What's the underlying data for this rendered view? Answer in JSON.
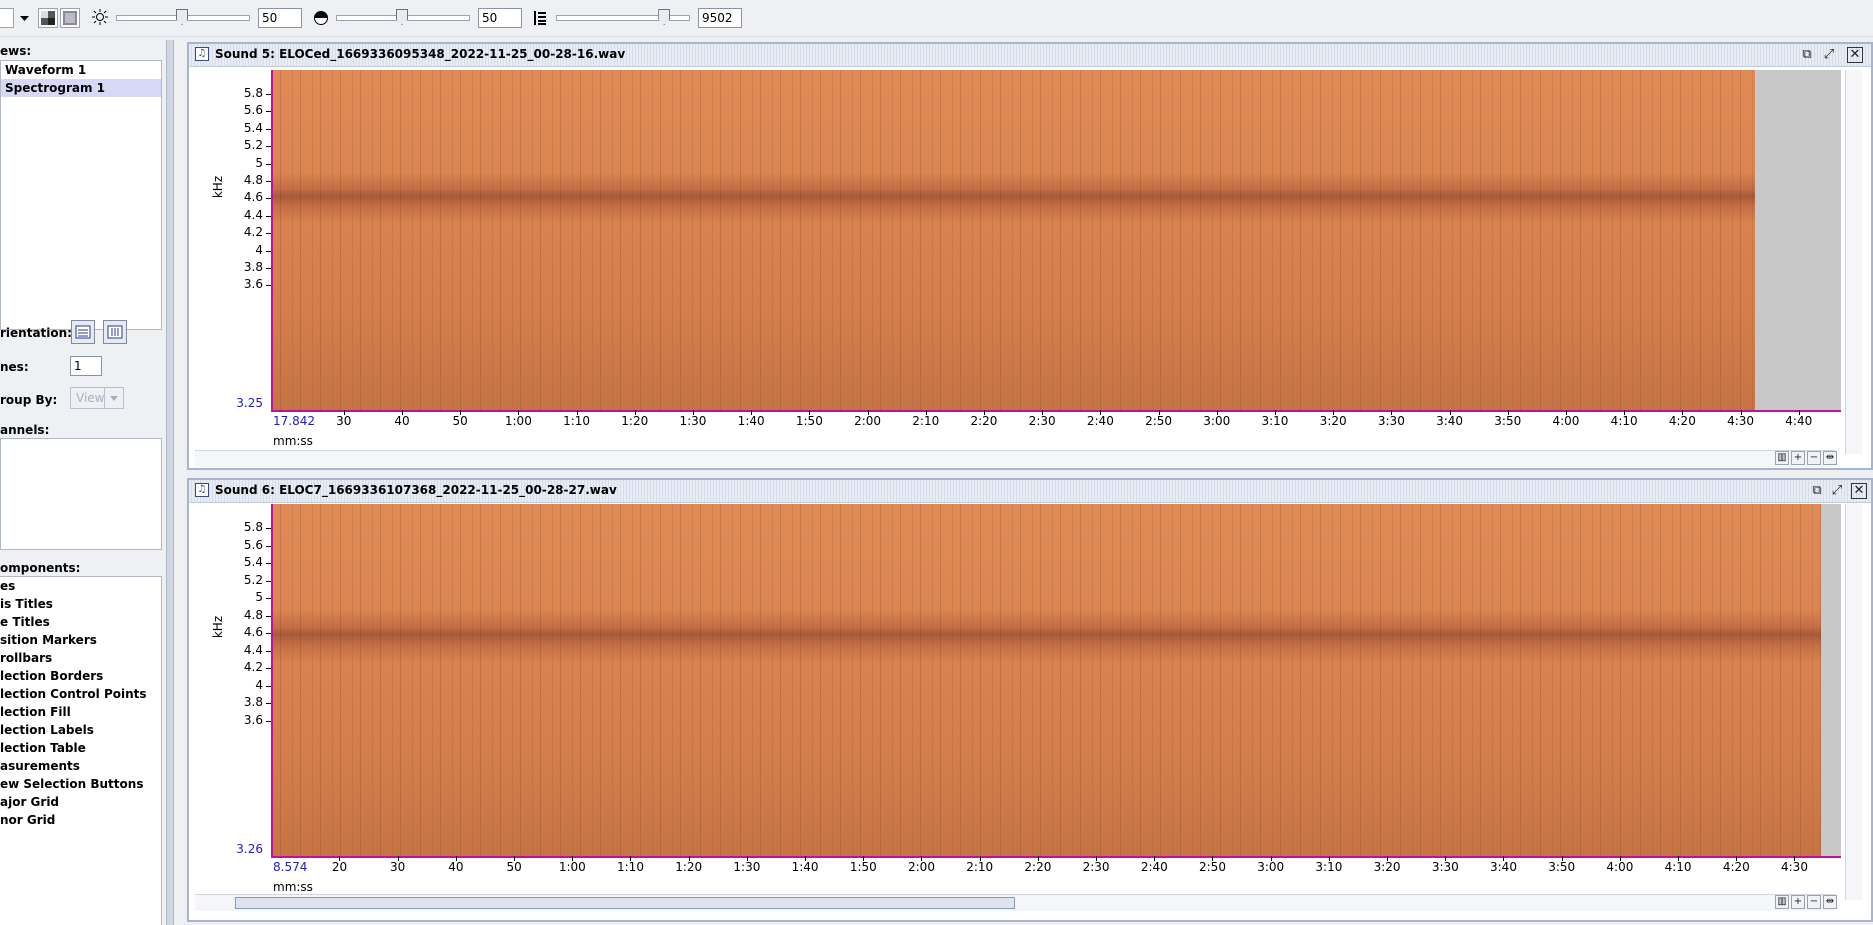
{
  "toolbar": {
    "brightness_value": "50",
    "brightness_level": 0.5,
    "contrast_value": "50",
    "contrast_level": 0.5,
    "resolution_value": "9502",
    "resolution_level": 0.82,
    "icons": [
      "dropdown-arrow-icon",
      "grayscale-icon",
      "colormap-icon",
      "brightness-icon",
      "contrast-icon",
      "resolution-icon"
    ]
  },
  "left_panel": {
    "views_label": "ews:",
    "views": [
      {
        "label": "Waveform 1",
        "selected": false
      },
      {
        "label": "Spectrogram 1",
        "selected": true
      }
    ],
    "orientation_label": "rientation:",
    "lines_label": "nes:",
    "lines_value": "1",
    "group_by_label": "roup By:",
    "group_by_value": "View",
    "channels_label": "annels:",
    "components_label": "omponents:",
    "components": [
      "es",
      "is Titles",
      "e Titles",
      "sition Markers",
      "rollbars",
      "lection Borders",
      "lection Control Points",
      "lection Fill",
      "lection Labels",
      "lection Table",
      "asurements",
      "ew Selection Buttons",
      "ajor Grid",
      "nor Grid"
    ]
  },
  "sounds": [
    {
      "title": "Sound 5: ELOCed_1669336095348_2022-11-25_00-28-16.wav",
      "y_label": "kHz",
      "y_min_label": "3.25",
      "y_ticks": [
        "5.8",
        "5.6",
        "5.4",
        "5.2",
        "5",
        "4.8",
        "4.6",
        "4.4",
        "4.2",
        "4",
        "3.8",
        "3.6"
      ],
      "x_start_label": "17.842",
      "x_ticks": [
        "30",
        "40",
        "50",
        "1:00",
        "1:10",
        "1:20",
        "1:30",
        "1:40",
        "1:50",
        "2:00",
        "2:10",
        "2:20",
        "2:30",
        "2:40",
        "2:50",
        "3:00",
        "3:10",
        "3:20",
        "3:30",
        "3:40",
        "3:50",
        "4:00",
        "4:10",
        "4:20",
        "4:30",
        "4:40"
      ],
      "x_label": "mm:ss",
      "x_start_seconds": 17.842,
      "x_tick_seconds": [
        30,
        40,
        50,
        60,
        70,
        80,
        90,
        100,
        110,
        120,
        130,
        140,
        150,
        160,
        170,
        180,
        190,
        200,
        210,
        220,
        230,
        240,
        250,
        260,
        270,
        280
      ],
      "data_end_seconds": 272.5
    },
    {
      "title": "Sound 6: ELOC7_1669336107368_2022-11-25_00-28-27.wav",
      "y_label": "kHz",
      "y_min_label": "3.26",
      "y_ticks": [
        "5.8",
        "5.6",
        "5.4",
        "5.2",
        "5",
        "4.8",
        "4.6",
        "4.4",
        "4.2",
        "4",
        "3.8",
        "3.6"
      ],
      "x_start_label": "8.574",
      "x_ticks": [
        "20",
        "30",
        "40",
        "50",
        "1:00",
        "1:10",
        "1:20",
        "1:30",
        "1:40",
        "1:50",
        "2:00",
        "2:10",
        "2:20",
        "2:30",
        "2:40",
        "2:50",
        "3:00",
        "3:10",
        "3:20",
        "3:30",
        "3:40",
        "3:50",
        "4:00",
        "4:10",
        "4:20",
        "4:30"
      ],
      "x_label": "mm:ss",
      "x_start_seconds": 8.574,
      "x_tick_seconds": [
        20,
        30,
        40,
        50,
        60,
        70,
        80,
        90,
        100,
        110,
        120,
        130,
        140,
        150,
        160,
        170,
        180,
        190,
        200,
        210,
        220,
        230,
        240,
        250,
        260,
        270
      ],
      "data_end_seconds": 274.5
    }
  ],
  "colors": {
    "accent": "#2020c0",
    "spectrogram": "#db8552",
    "axis_line": "#c010a0"
  }
}
